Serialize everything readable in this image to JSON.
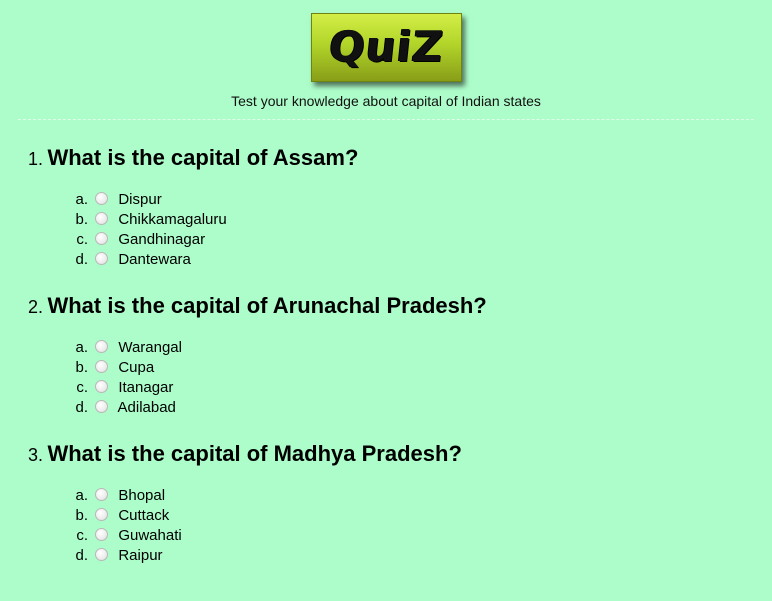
{
  "header": {
    "logo_text": "QuiZ",
    "subtitle": "Test your knowledge about capital of Indian states"
  },
  "questions": [
    {
      "number": "1.",
      "text": "What is the capital of Assam?",
      "options": [
        {
          "letter": "a.",
          "label": "Dispur"
        },
        {
          "letter": "b.",
          "label": "Chikkamagaluru"
        },
        {
          "letter": "c.",
          "label": "Gandhinagar"
        },
        {
          "letter": "d.",
          "label": "Dantewara"
        }
      ]
    },
    {
      "number": "2.",
      "text": "What is the capital of Arunachal Pradesh?",
      "options": [
        {
          "letter": "a.",
          "label": "Warangal"
        },
        {
          "letter": "b.",
          "label": "Cupa"
        },
        {
          "letter": "c.",
          "label": "Itanagar"
        },
        {
          "letter": "d.",
          "label": "Adilabad"
        }
      ]
    },
    {
      "number": "3.",
      "text": "What is the capital of Madhya Pradesh?",
      "options": [
        {
          "letter": "a.",
          "label": "Bhopal"
        },
        {
          "letter": "b.",
          "label": "Cuttack"
        },
        {
          "letter": "c.",
          "label": "Guwahati"
        },
        {
          "letter": "d.",
          "label": "Raipur"
        }
      ]
    }
  ]
}
